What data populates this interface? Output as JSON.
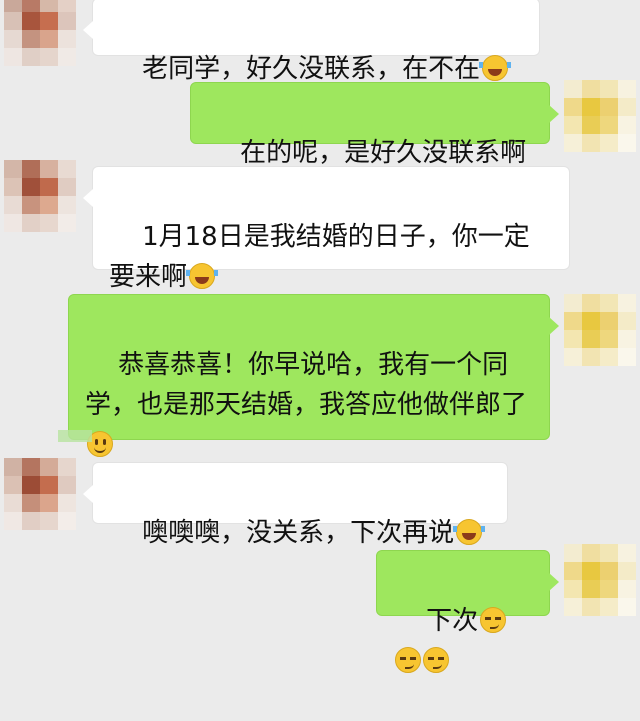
{
  "colors": {
    "chat_background": "#ebebeb",
    "incoming_bubble": "#ffffff",
    "outgoing_bubble": "#9ee75e"
  },
  "messages": [
    {
      "direction": "incoming",
      "text": "老同学，好久没联系，在不在",
      "emoji": [
        "face-with-tears-of-joy-icon"
      ]
    },
    {
      "direction": "outgoing",
      "text": "在的呢，是好久没联系啊",
      "emoji": []
    },
    {
      "direction": "incoming",
      "text": "1月18日是我结婚的日子，你一定要来啊",
      "emoji": [
        "face-with-tears-of-joy-icon"
      ]
    },
    {
      "direction": "outgoing",
      "text": "恭喜恭喜！你早说哈，我有一个同学，也是那天结婚，我答应他做伴郎了",
      "emoji": [
        "smiling-face-icon"
      ]
    },
    {
      "direction": "incoming",
      "text": "噢噢噢，没关系，下次再说",
      "emoji": [
        "face-with-tears-of-joy-icon"
      ]
    },
    {
      "direction": "outgoing",
      "text": "下次",
      "emoji": [
        "smirking-face-icon",
        "smirking-face-icon",
        "smirking-face-icon"
      ]
    }
  ]
}
